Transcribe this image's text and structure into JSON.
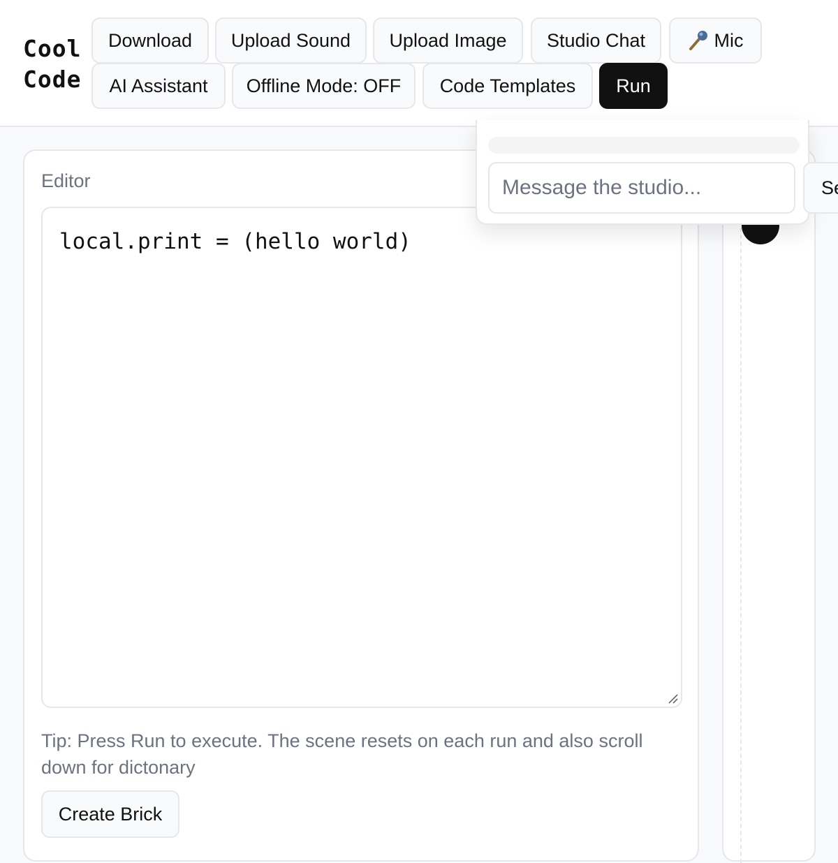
{
  "app": {
    "logo_line1": "Cool",
    "logo_line2": "Code"
  },
  "toolbar": {
    "download": "Download",
    "upload_sound": "Upload Sound",
    "upload_image": "Upload Image",
    "studio_chat": "Studio Chat",
    "mic": "Mic",
    "mic_icon": "microphone-icon",
    "ai_assistant": "AI Assistant",
    "offline_mode": "Offline Mode: OFF",
    "code_templates": "Code Templates",
    "run": "Run"
  },
  "editor": {
    "label": "Editor",
    "code": "local.print = (hello world)",
    "tip": "Tip: Press Run to execute. The scene resets on each run and also scroll down for dictonary",
    "create_brick": "Create Brick"
  },
  "chat": {
    "input_placeholder": "Message the studio...",
    "send_label": "Send"
  },
  "colors": {
    "accent": "#111111",
    "border": "#e5e7eb",
    "muted_text": "#6b7280",
    "background": "#f9fafb"
  }
}
